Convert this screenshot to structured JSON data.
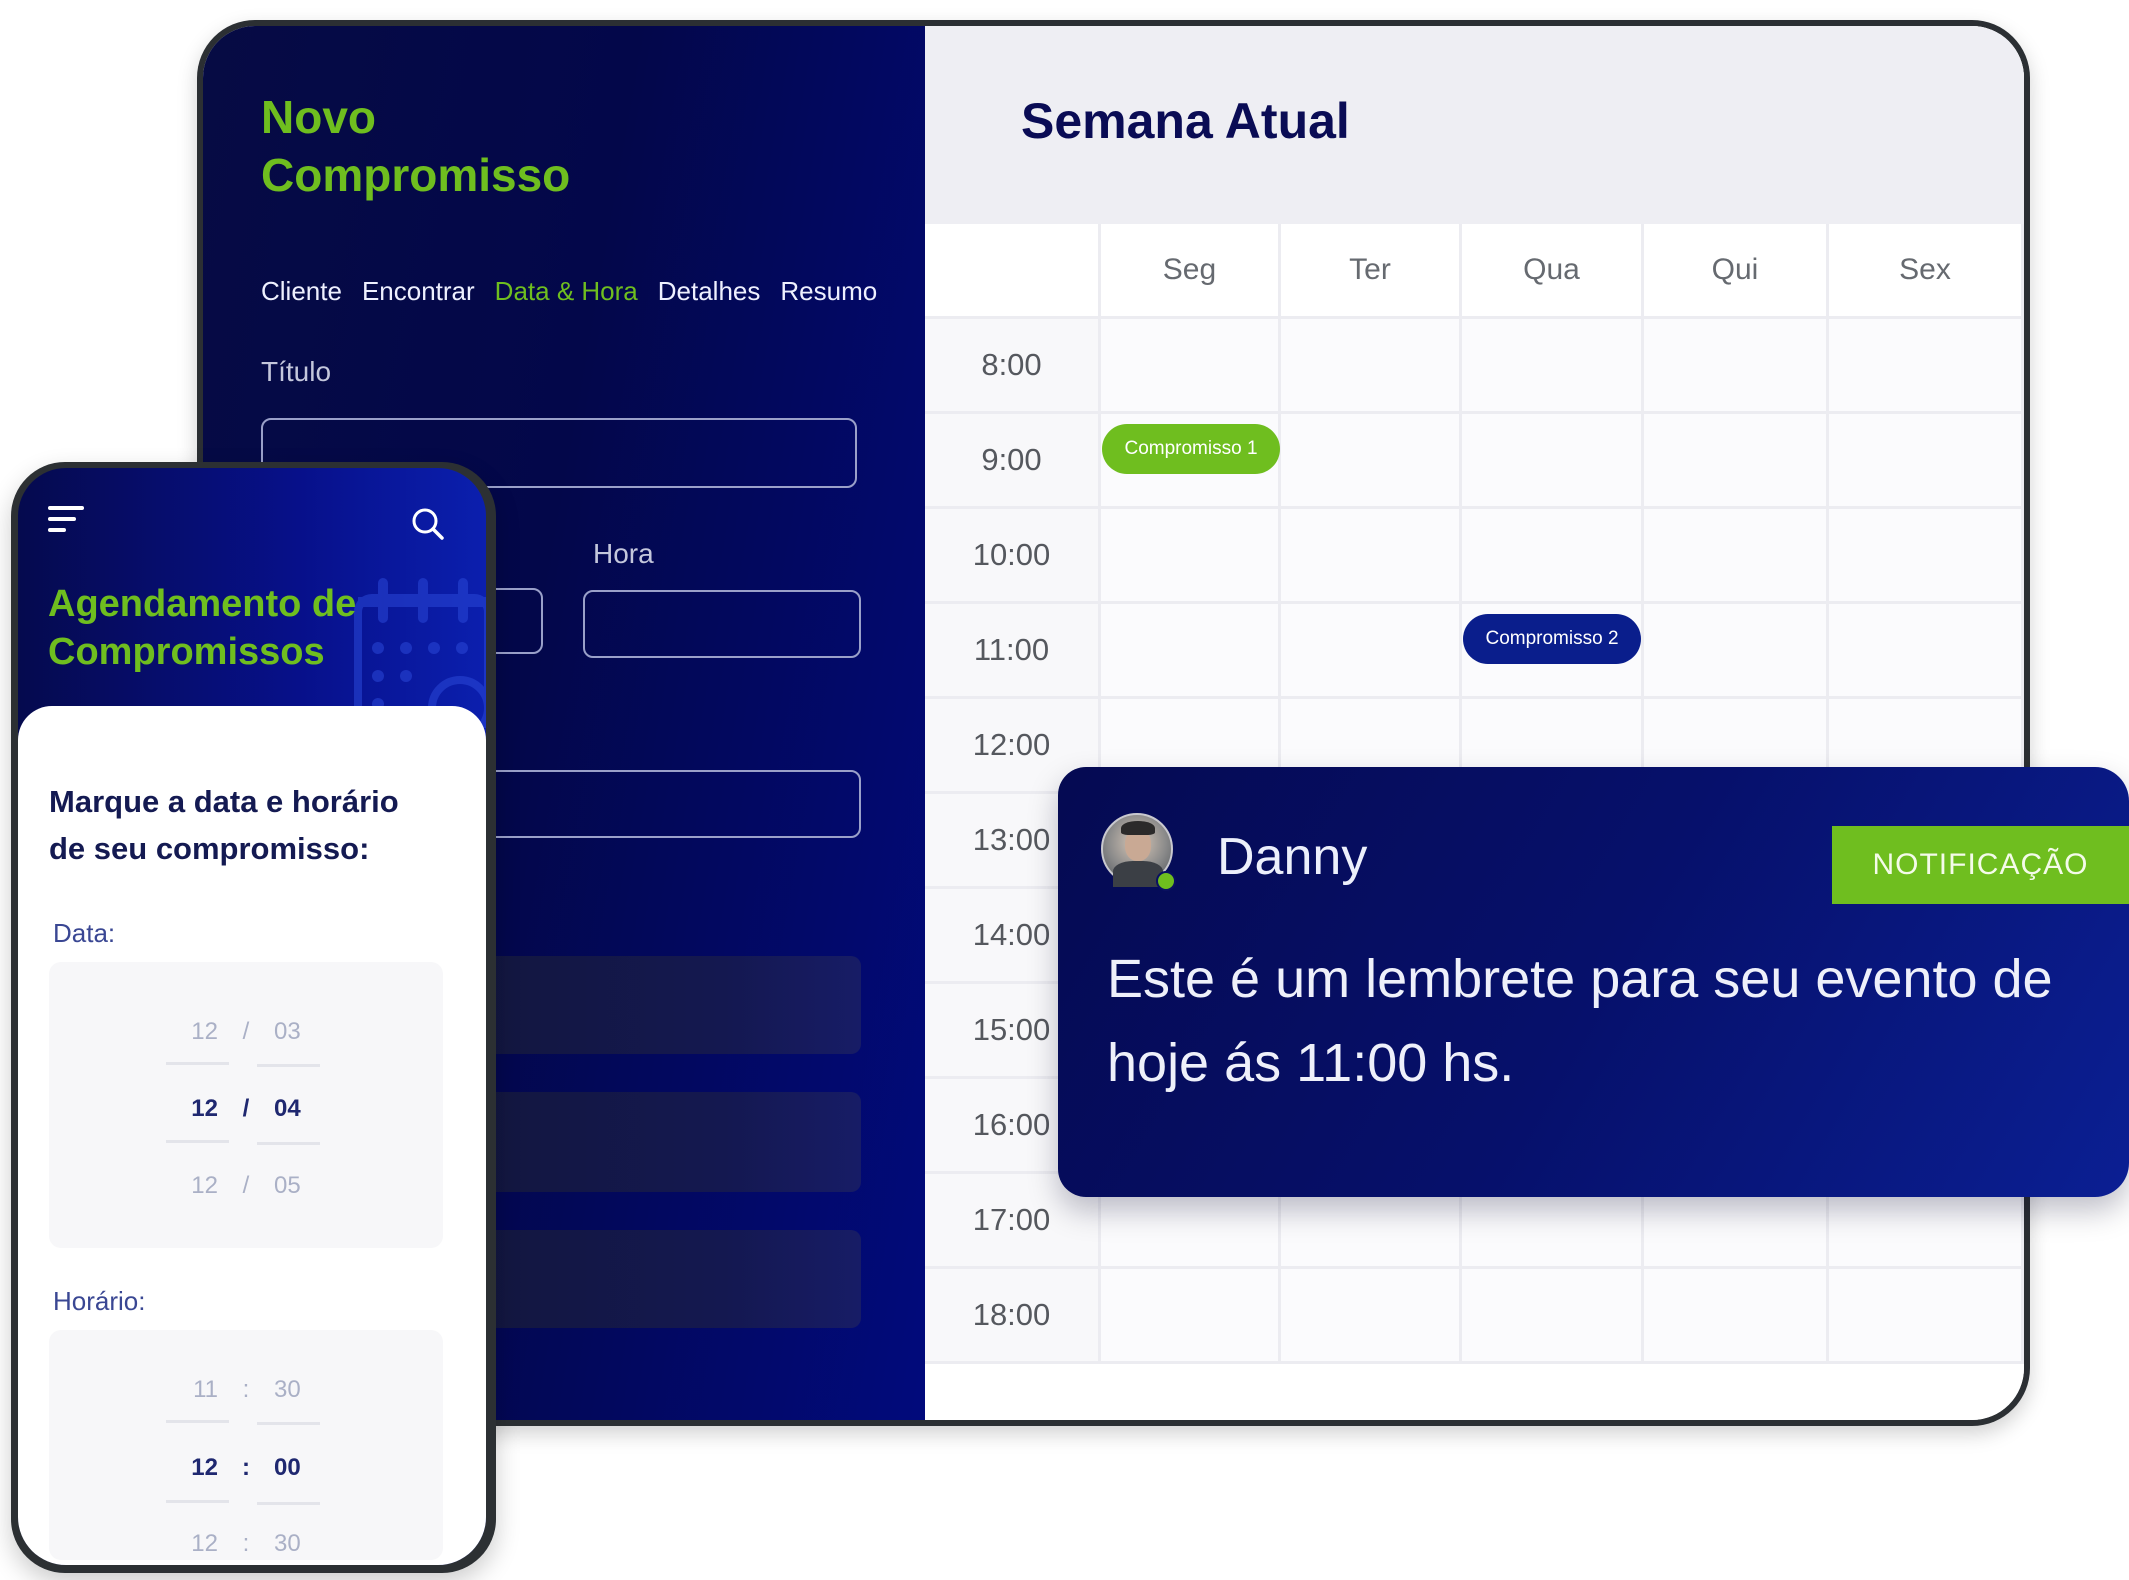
{
  "desktop": {
    "form_panel": {
      "title_line1": "Novo",
      "title_line2": "Compromisso",
      "tabs": [
        {
          "label": "Cliente",
          "active": false
        },
        {
          "label": "Encontrar",
          "active": false
        },
        {
          "label": "Data & Hora",
          "active": true
        },
        {
          "label": "Detalhes",
          "active": false
        },
        {
          "label": "Resumo",
          "active": false
        }
      ],
      "fields": {
        "titulo_label": "Título",
        "titulo_value": "",
        "data_value": "",
        "hora_label": "Hora",
        "hora_value": "",
        "extra_value": ""
      }
    },
    "calendar": {
      "title": "Semana Atual",
      "days": [
        "Seg",
        "Ter",
        "Qua",
        "Qui",
        "Sex"
      ],
      "times": [
        "8:00",
        "9:00",
        "10:00",
        "11:00",
        "12:00",
        "13:00",
        "14:00",
        "15:00",
        "16:00",
        "17:00",
        "18:00"
      ],
      "events": [
        {
          "label": "Compromisso 1",
          "day": "Seg",
          "time": "9:00",
          "color": "#6fbe1f"
        },
        {
          "label": "Compromisso 2",
          "day": "Qua",
          "time": "11:00",
          "color": "#0a1e8c"
        }
      ]
    }
  },
  "notification": {
    "sender": "Danny",
    "status": "online",
    "badge": "NOTIFICAÇÃO",
    "message": "Este é um lembrete para seu evento de hoje ás 11:00 hs."
  },
  "phone": {
    "title_line1": "Agendamento de",
    "title_line2": "Compromissos",
    "question_line1": "Marque a data e horário",
    "question_line2": "de seu compromisso:",
    "date_label": "Data:",
    "date_options": [
      {
        "day": "12",
        "sep": "/",
        "month": "03",
        "selected": false
      },
      {
        "day": "12",
        "sep": "/",
        "month": "04",
        "selected": true
      },
      {
        "day": "12",
        "sep": "/",
        "month": "05",
        "selected": false
      }
    ],
    "time_label": "Horário:",
    "time_options": [
      {
        "hour": "11",
        "sep": ":",
        "minute": "30",
        "selected": false
      },
      {
        "hour": "12",
        "sep": ":",
        "minute": "00",
        "selected": true
      },
      {
        "hour": "12",
        "sep": ":",
        "minute": "30",
        "selected": false
      }
    ]
  },
  "colors": {
    "accent_green": "#6fbe1f",
    "navy": "#0a0c55",
    "event_blue": "#0a1e8c"
  }
}
